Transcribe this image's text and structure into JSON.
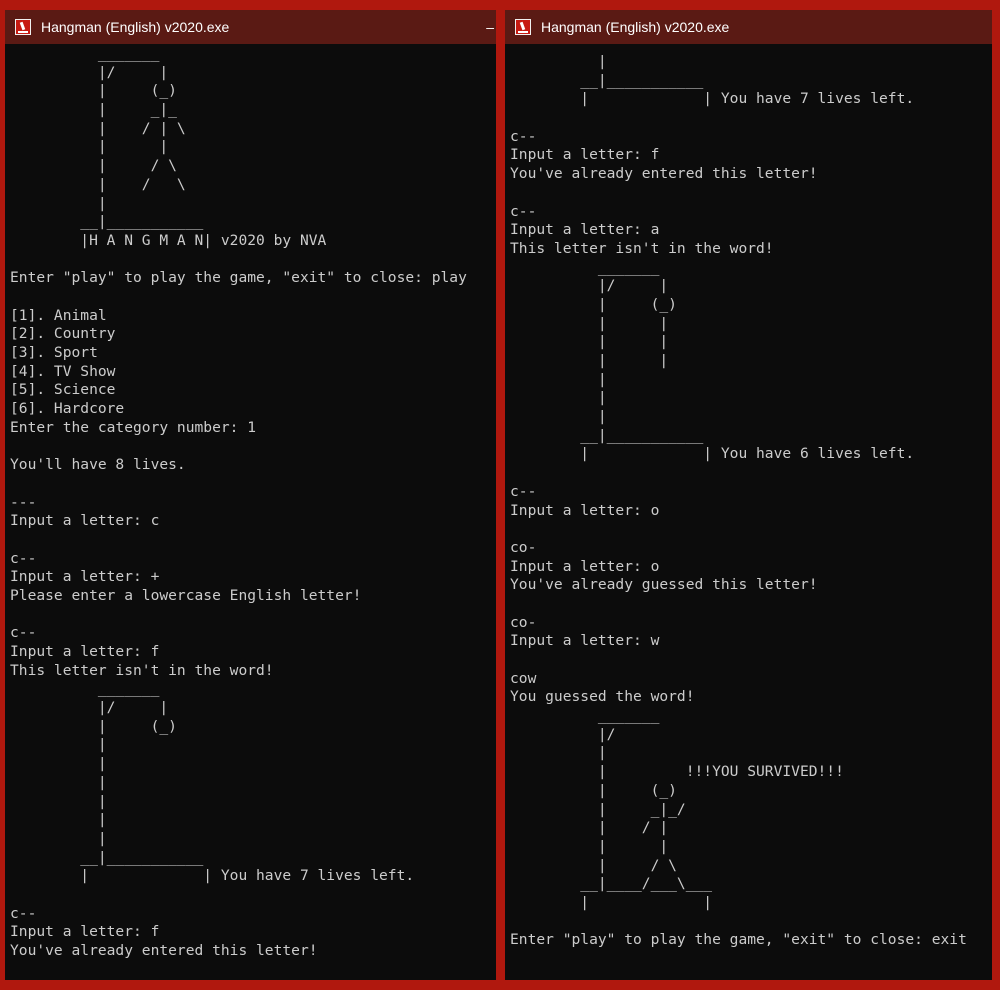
{
  "left_window": {
    "title": "Hangman (English) v2020.exe",
    "lines": [
      "          _______",
      "          |/     |",
      "          |     (_)",
      "          |     _|_",
      "          |    / | \\",
      "          |      |",
      "          |     / \\",
      "          |    /   \\",
      "          |",
      "        __|___________",
      "        |H A N G M A N| v2020 by NVA",
      "",
      "Enter \"play\" to play the game, \"exit\" to close: play",
      "",
      "[1]. Animal",
      "[2]. Country",
      "[3]. Sport",
      "[4]. TV Show",
      "[5]. Science",
      "[6]. Hardcore",
      "Enter the category number: 1",
      "",
      "You'll have 8 lives.",
      "",
      "---",
      "Input a letter: c",
      "",
      "c--",
      "Input a letter: +",
      "Please enter a lowercase English letter!",
      "",
      "c--",
      "Input a letter: f",
      "This letter isn't in the word!",
      "          _______",
      "          |/     |",
      "          |     (_)",
      "          |",
      "          |",
      "          |",
      "          |",
      "          |",
      "          |",
      "        __|___________",
      "        |             | You have 7 lives left.",
      "",
      "c--",
      "Input a letter: f",
      "You've already entered this letter!"
    ]
  },
  "right_window": {
    "title": "Hangman (English) v2020.exe",
    "lines": [
      "          |",
      "        __|___________",
      "        |             | You have 7 lives left.",
      "",
      "c--",
      "Input a letter: f",
      "You've already entered this letter!",
      "",
      "c--",
      "Input a letter: a",
      "This letter isn't in the word!",
      "          _______",
      "          |/     |",
      "          |     (_)",
      "          |      |",
      "          |      |",
      "          |      |",
      "          |",
      "          |",
      "          |",
      "        __|___________",
      "        |             | You have 6 lives left.",
      "",
      "c--",
      "Input a letter: o",
      "",
      "co-",
      "Input a letter: o",
      "You've already guessed this letter!",
      "",
      "co-",
      "Input a letter: w",
      "",
      "cow",
      "You guessed the word!",
      "          _______",
      "          |/",
      "          |",
      "          |         !!!YOU SURVIVED!!!",
      "          |     (_)",
      "          |     _|_/",
      "          |    / |",
      "          |      |",
      "          |     / \\",
      "        __|____/___\\___",
      "        |             |",
      "",
      "Enter \"play\" to play the game, \"exit\" to close: exit"
    ]
  }
}
